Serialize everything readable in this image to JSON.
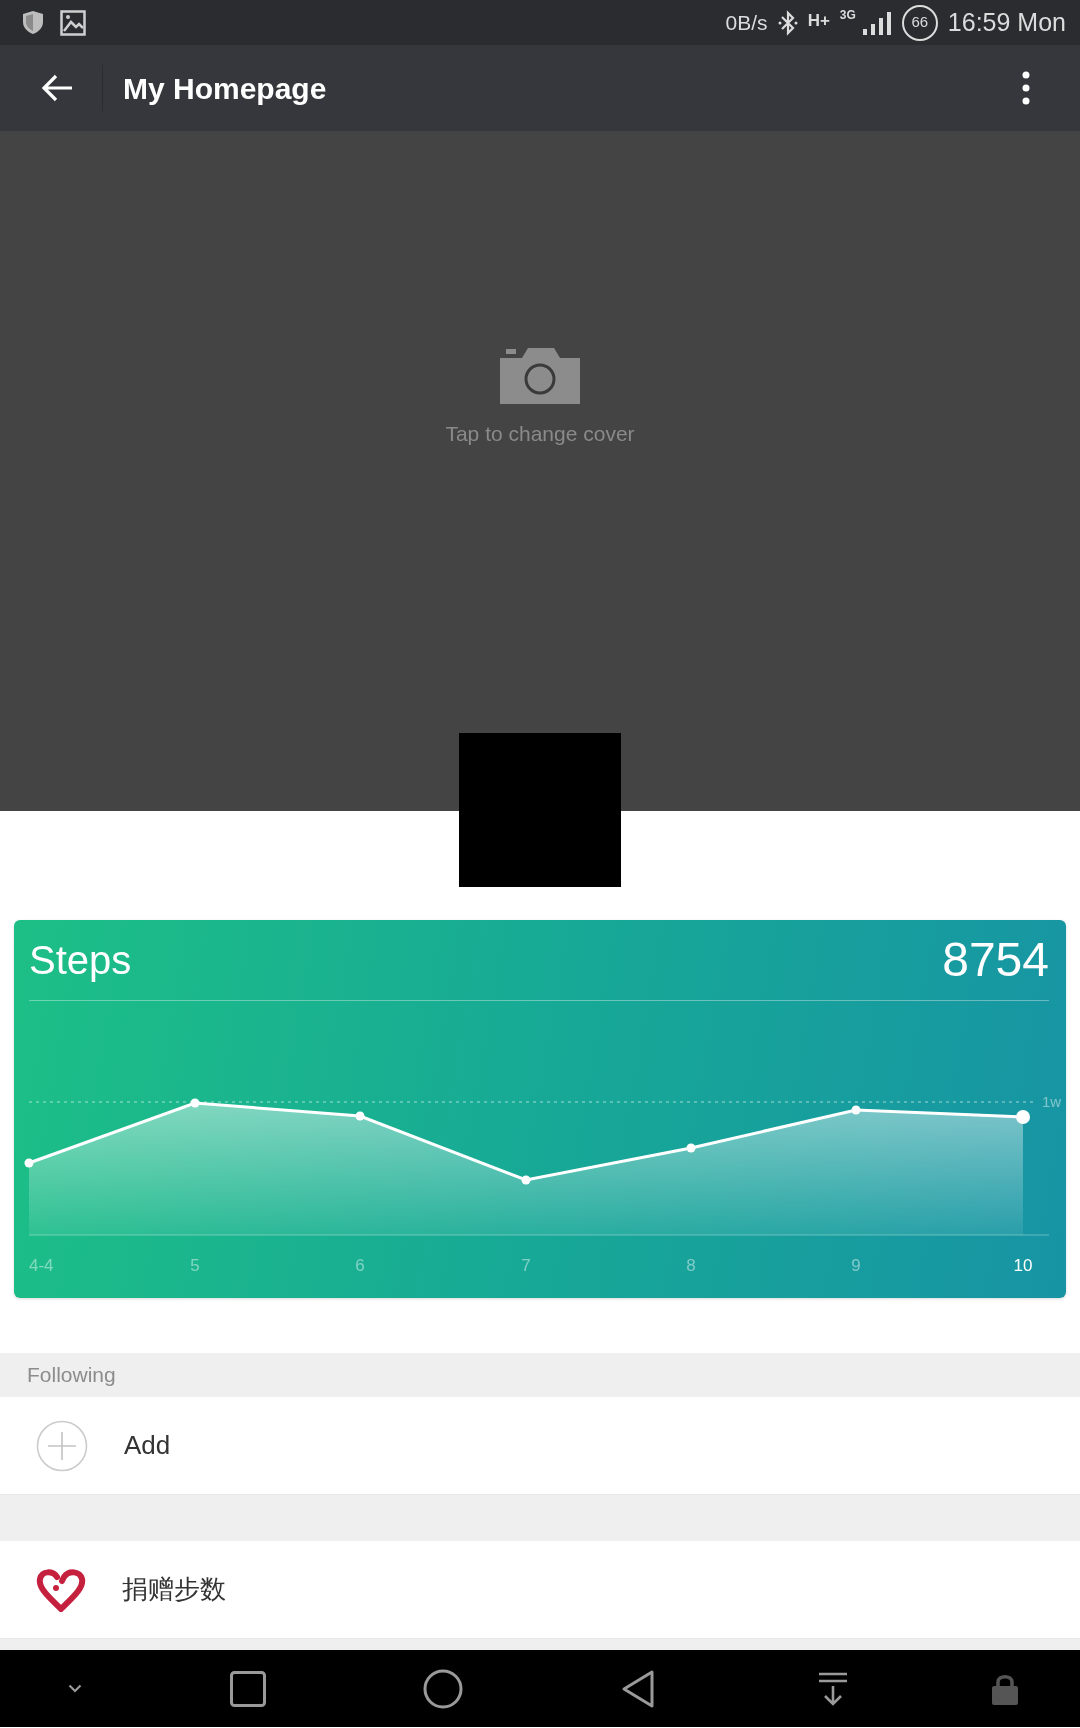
{
  "status_bar": {
    "speed": "0B/s",
    "network_type": "H+",
    "signal_type": "3G",
    "battery": "66",
    "time": "16:59 Mon"
  },
  "toolbar": {
    "title": "My Homepage"
  },
  "cover": {
    "hint": "Tap to change cover"
  },
  "steps_card": {
    "title": "Steps",
    "count": "8754",
    "reference_label": "1w",
    "days": [
      {
        "label": "4-4",
        "selected": false
      },
      {
        "label": "5",
        "selected": false
      },
      {
        "label": "6",
        "selected": false
      },
      {
        "label": "7",
        "selected": false
      },
      {
        "label": "8",
        "selected": false
      },
      {
        "label": "9",
        "selected": false
      },
      {
        "label": "10",
        "selected": true
      }
    ]
  },
  "sections": [
    {
      "header": "Following",
      "items": [
        {
          "kind": "add",
          "label": "Add"
        }
      ]
    },
    {
      "items": [
        {
          "kind": "donate",
          "label": "捐赠步数"
        }
      ]
    }
  ]
}
